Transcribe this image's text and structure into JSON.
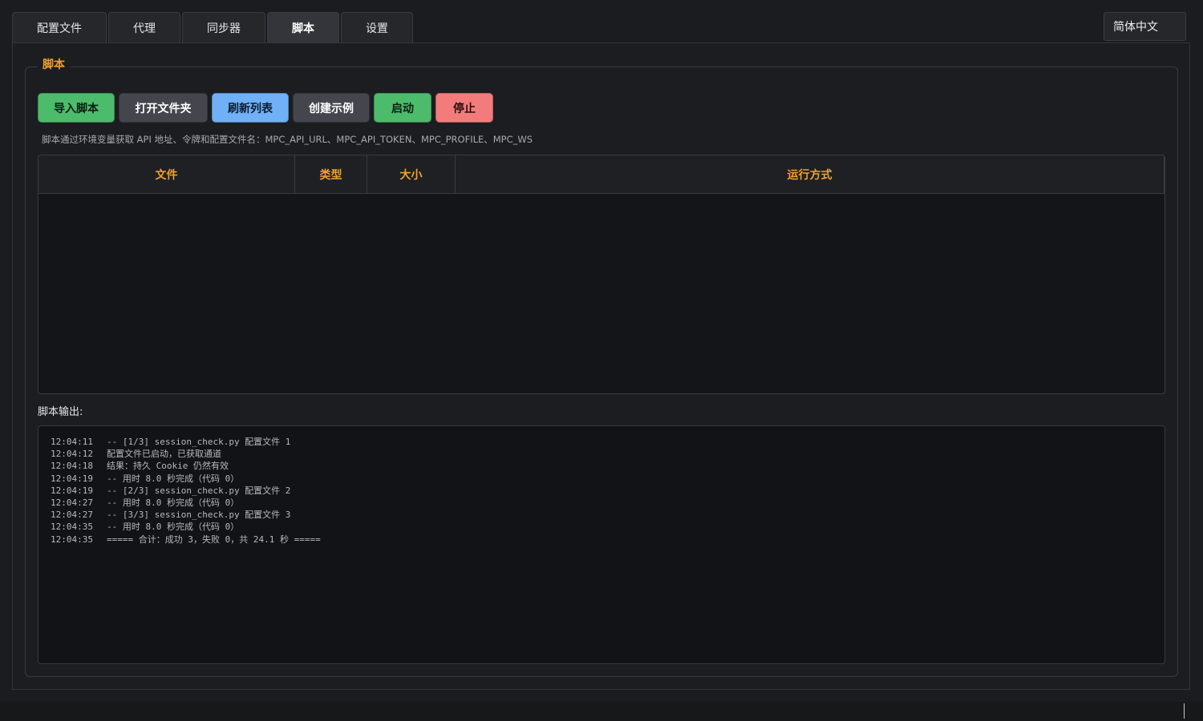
{
  "tabs": [
    {
      "label": "配置文件",
      "active": false
    },
    {
      "label": "代理",
      "active": false
    },
    {
      "label": "同步器",
      "active": false
    },
    {
      "label": "脚本",
      "active": true
    },
    {
      "label": "设置",
      "active": false
    }
  ],
  "language": {
    "selected": "简体中文"
  },
  "script_group": {
    "title": "脚本",
    "buttons": {
      "import": "导入脚本",
      "open_folder": "打开文件夹",
      "refresh": "刷新列表",
      "create_example": "创建示例",
      "start": "启动",
      "stop": "停止"
    },
    "hint": "脚本通过环境变量获取 API 地址、令牌和配置文件名：MPC_API_URL、MPC_API_TOKEN、MPC_PROFILE、MPC_WS",
    "table": {
      "columns": [
        "文件",
        "类型",
        "大小",
        "运行方式"
      ],
      "rows": []
    },
    "output_label": "脚本输出:",
    "output_lines": [
      {
        "time": "12:04:11",
        "text": "-- [1/3] session_check.py 配置文件 1"
      },
      {
        "time": "12:04:12",
        "text": "配置文件已启动，已获取通道"
      },
      {
        "time": "12:04:18",
        "text": "结果：持久 Cookie 仍然有效"
      },
      {
        "time": "12:04:19",
        "text": "-- 用时 8.0 秒完成（代码 0）"
      },
      {
        "time": "12:04:19",
        "text": "-- [2/3] session_check.py 配置文件 2"
      },
      {
        "time": "12:04:27",
        "text": "-- 用时 8.0 秒完成（代码 0）"
      },
      {
        "time": "12:04:27",
        "text": "-- [3/3] session_check.py 配置文件 3"
      },
      {
        "time": "12:04:35",
        "text": "-- 用时 8.0 秒完成（代码 0）"
      },
      {
        "time": "12:04:35",
        "text": "===== 合计：成功 3，失败 0，共 24.1 秒 ====="
      }
    ]
  },
  "colors": {
    "accent_orange": "#f0a030",
    "button_green": "#4dbb6c",
    "button_blue": "#6fb0f7",
    "button_red": "#f27c7c",
    "button_gray": "#45464d"
  }
}
